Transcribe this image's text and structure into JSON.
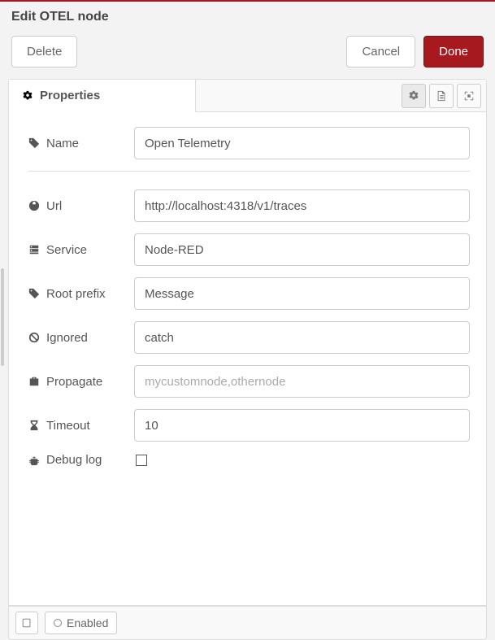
{
  "header": {
    "title": "Edit OTEL node"
  },
  "buttons": {
    "delete": "Delete",
    "cancel": "Cancel",
    "done": "Done"
  },
  "tabs": {
    "properties_label": "Properties"
  },
  "form": {
    "name": {
      "label": "Name",
      "value": "Open Telemetry"
    },
    "url": {
      "label": "Url",
      "value": "http://localhost:4318/v1/traces"
    },
    "service": {
      "label": "Service",
      "value": "Node-RED"
    },
    "root_prefix": {
      "label": "Root prefix",
      "value": "Message"
    },
    "ignored": {
      "label": "Ignored",
      "value": "catch"
    },
    "propagate": {
      "label": "Propagate",
      "value": "",
      "placeholder": "mycustomnode,othernode"
    },
    "timeout": {
      "label": "Timeout",
      "value": "10"
    },
    "debug_log": {
      "label": "Debug log",
      "checked": false
    }
  },
  "footer": {
    "enabled_label": "Enabled"
  }
}
